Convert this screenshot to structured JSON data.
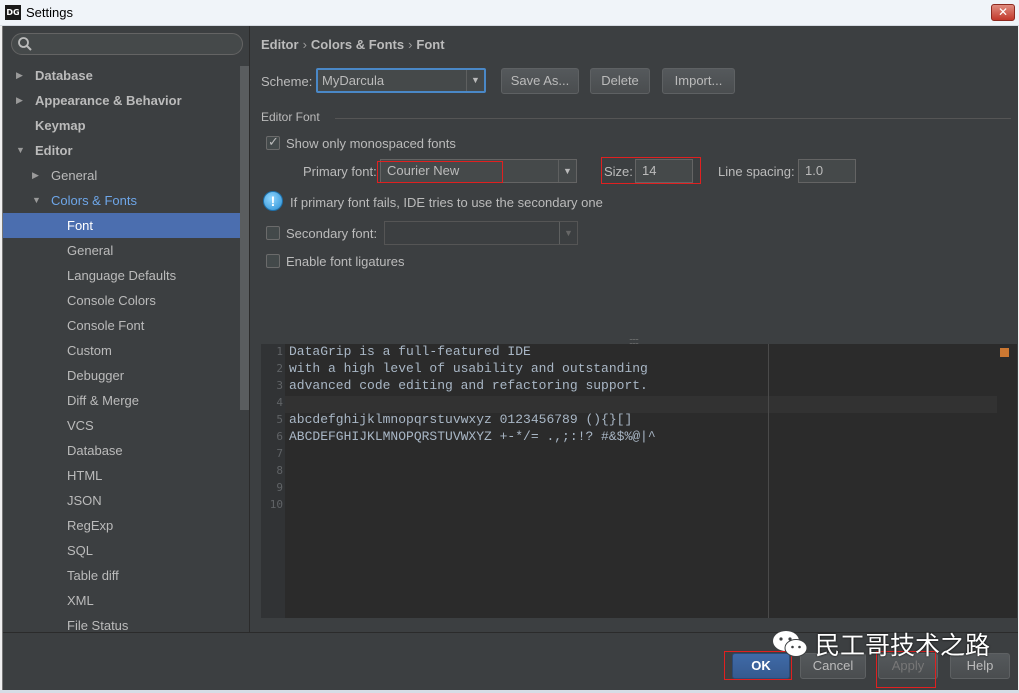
{
  "window": {
    "title": "Settings",
    "app_icon_text": "DG",
    "close_label": "✕"
  },
  "sidebar": {
    "search": {
      "placeholder": "",
      "value": ""
    },
    "items": [
      {
        "label": "Database",
        "arrow": "▶",
        "indent": 0,
        "bold": true
      },
      {
        "label": "Appearance & Behavior",
        "arrow": "▶",
        "indent": 0,
        "bold": true
      },
      {
        "label": "Keymap",
        "arrow": "",
        "indent": 0,
        "bold": true
      },
      {
        "label": "Editor",
        "arrow": "▼",
        "indent": 0,
        "bold": true
      },
      {
        "label": "General",
        "arrow": "▶",
        "indent": 1,
        "bold": false
      },
      {
        "label": "Colors & Fonts",
        "arrow": "▼",
        "indent": 1,
        "bold": false,
        "highlight": true
      },
      {
        "label": "Font",
        "arrow": "",
        "indent": 2,
        "bold": false,
        "selected": true
      },
      {
        "label": "General",
        "arrow": "",
        "indent": 2,
        "bold": false
      },
      {
        "label": "Language Defaults",
        "arrow": "",
        "indent": 2,
        "bold": false
      },
      {
        "label": "Console Colors",
        "arrow": "",
        "indent": 2,
        "bold": false
      },
      {
        "label": "Console Font",
        "arrow": "",
        "indent": 2,
        "bold": false
      },
      {
        "label": "Custom",
        "arrow": "",
        "indent": 2,
        "bold": false
      },
      {
        "label": "Debugger",
        "arrow": "",
        "indent": 2,
        "bold": false
      },
      {
        "label": "Diff & Merge",
        "arrow": "",
        "indent": 2,
        "bold": false
      },
      {
        "label": "VCS",
        "arrow": "",
        "indent": 2,
        "bold": false
      },
      {
        "label": "Database",
        "arrow": "",
        "indent": 2,
        "bold": false
      },
      {
        "label": "HTML",
        "arrow": "",
        "indent": 2,
        "bold": false
      },
      {
        "label": "JSON",
        "arrow": "",
        "indent": 2,
        "bold": false
      },
      {
        "label": "RegExp",
        "arrow": "",
        "indent": 2,
        "bold": false
      },
      {
        "label": "SQL",
        "arrow": "",
        "indent": 2,
        "bold": false
      },
      {
        "label": "Table diff",
        "arrow": "",
        "indent": 2,
        "bold": false
      },
      {
        "label": "XML",
        "arrow": "",
        "indent": 2,
        "bold": false
      },
      {
        "label": "File Status",
        "arrow": "",
        "indent": 2,
        "bold": false
      }
    ]
  },
  "breadcrumb": {
    "part1": "Editor",
    "part2": "Colors & Fonts",
    "part3": "Font",
    "separator": "›"
  },
  "scheme": {
    "label": "Scheme:",
    "value": "MyDarcula",
    "save_as": "Save As...",
    "delete": "Delete",
    "import": "Import..."
  },
  "editor_font": {
    "section_title": "Editor Font",
    "show_monospaced": {
      "label": "Show only monospaced fonts",
      "checked": true
    },
    "primary_font": {
      "label": "Primary font:",
      "value": "Courier New"
    },
    "size": {
      "label": "Size:",
      "value": "14"
    },
    "line_spacing": {
      "label": "Line spacing:",
      "value": "1.0"
    },
    "info_text": "If primary font fails, IDE tries to use the secondary one",
    "info_icon": "!",
    "secondary_font": {
      "label": "Secondary font:",
      "value": "",
      "checked": false
    },
    "ligatures": {
      "label": "Enable font ligatures",
      "checked": false
    }
  },
  "splitter": "::::::",
  "preview": {
    "line_numbers": [
      "1",
      "2",
      "3",
      "4",
      "5",
      "6",
      "7",
      "8",
      "9",
      "10"
    ],
    "lines": [
      "DataGrip is a full-featured IDE",
      "with a high level of usability and outstanding",
      "advanced code editing and refactoring support.",
      "",
      "abcdefghijklmnopqrstuvwxyz 0123456789 (){}[]",
      "ABCDEFGHIJKLMNOPQRSTUVWXYZ +-*/= .,;:!? #&$%@|^",
      "",
      "",
      "",
      ""
    ]
  },
  "footer": {
    "ok": "OK",
    "cancel": "Cancel",
    "apply": "Apply",
    "help": "Help"
  },
  "watermark": {
    "text": "民工哥技术之路"
  },
  "colors": {
    "accent": "#4b6eaf",
    "background": "#3c3f41",
    "editor_bg": "#2b2b2b",
    "highlight_box": "#e02020"
  }
}
